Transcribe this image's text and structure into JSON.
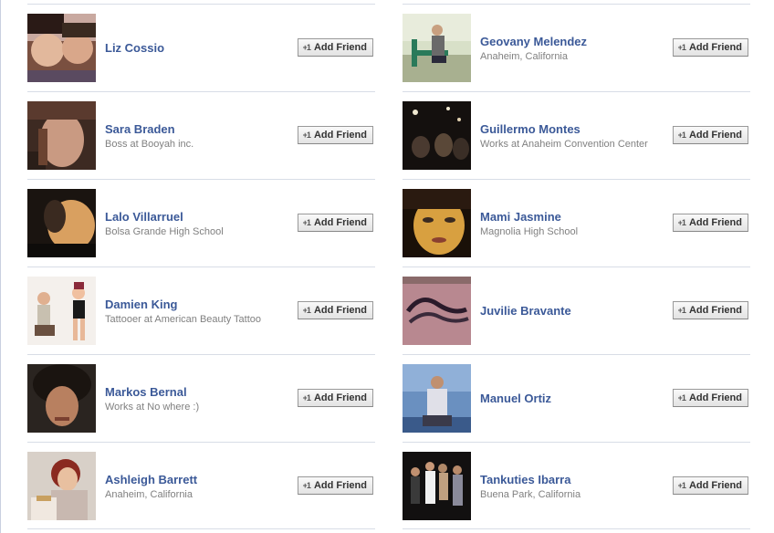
{
  "button_label": "Add Friend",
  "button_icon": "+1",
  "left_column": [
    {
      "name": "Liz Cossio",
      "sub": ""
    },
    {
      "name": "Sara Braden",
      "sub": "Boss at Booyah inc."
    },
    {
      "name": "Lalo Villarruel",
      "sub": "Bolsa Grande High School"
    },
    {
      "name": "Damien King",
      "sub": "Tattooer at American Beauty Tattoo"
    },
    {
      "name": "Markos Bernal",
      "sub": "Works at No where :)"
    },
    {
      "name": "Ashleigh Barrett",
      "sub": "Anaheim, California"
    }
  ],
  "right_column": [
    {
      "name": "Geovany Melendez",
      "sub": "Anaheim, California"
    },
    {
      "name": "Guillermo Montes",
      "sub": "Works at Anaheim Convention Center"
    },
    {
      "name": "Mami Jasmine",
      "sub": "Magnolia High School"
    },
    {
      "name": "Juvilie Bravante",
      "sub": ""
    },
    {
      "name": "Manuel Ortiz",
      "sub": ""
    },
    {
      "name": "Tankuties Ibarra",
      "sub": "Buena Park, California"
    }
  ],
  "colors": {
    "link": "#3b5998",
    "subtext": "#808080",
    "divider": "#d8dde6"
  }
}
